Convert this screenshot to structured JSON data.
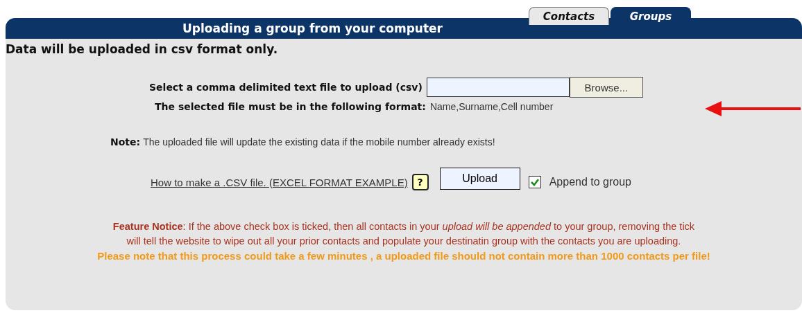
{
  "tabs": [
    {
      "label": "Contacts",
      "selected": false
    },
    {
      "label": "Groups",
      "selected": true
    }
  ],
  "header": {
    "title": "Uploading a group from your computer"
  },
  "intro": "Data will be uploaded in csv format only.",
  "file_select": {
    "label": "Select a comma delimited text file to upload (csv)",
    "button": "Browse..."
  },
  "format": {
    "label": "The selected file must be in the following format:",
    "value": "Name,Surname,Cell number"
  },
  "note": {
    "label": "Note:",
    "text": "The uploaded file will update the existing data if the mobile number already exists!"
  },
  "help_link": "How to make a .CSV file. (EXCEL FORMAT EXAMPLE)",
  "help_icon": "?",
  "upload_button": "Upload",
  "append": {
    "label": "Append to group",
    "checked": true
  },
  "notice_lines": [
    "**Feature Notice**: If the above check box is ticked, then all contacts in your *upload will be appended* to your group, removing the tick",
    "will tell the website to wipe out all your prior contacts and populate your destinatin group with the contacts you are uploading."
  ],
  "warning": "Please note that this process could take a few minutes , a uploaded file should not contain more than 1000 contacts per file!"
}
